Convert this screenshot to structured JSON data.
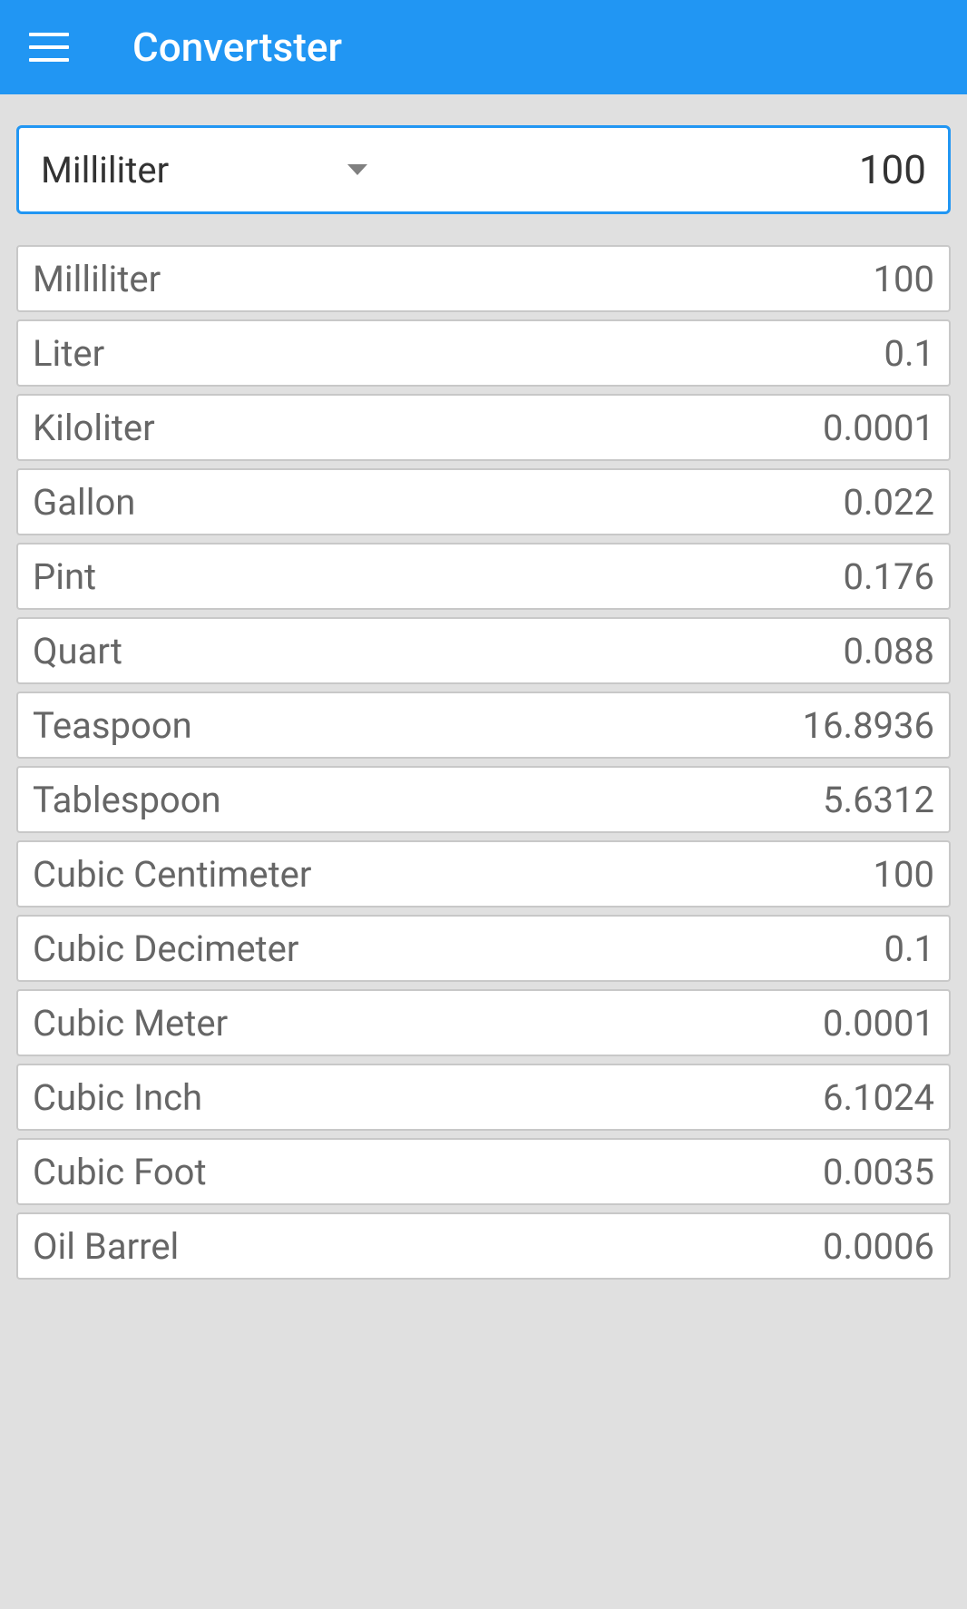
{
  "header": {
    "title": "Convertster"
  },
  "input": {
    "selected_unit": "Milliliter",
    "value": "100"
  },
  "results": [
    {
      "unit": "Milliliter",
      "value": "100"
    },
    {
      "unit": "Liter",
      "value": "0.1"
    },
    {
      "unit": "Kiloliter",
      "value": "0.0001"
    },
    {
      "unit": "Gallon",
      "value": "0.022"
    },
    {
      "unit": "Pint",
      "value": "0.176"
    },
    {
      "unit": "Quart",
      "value": "0.088"
    },
    {
      "unit": "Teaspoon",
      "value": "16.8936"
    },
    {
      "unit": "Tablespoon",
      "value": "5.6312"
    },
    {
      "unit": "Cubic Centimeter",
      "value": "100"
    },
    {
      "unit": "Cubic Decimeter",
      "value": "0.1"
    },
    {
      "unit": "Cubic Meter",
      "value": "0.0001"
    },
    {
      "unit": "Cubic Inch",
      "value": "6.1024"
    },
    {
      "unit": "Cubic Foot",
      "value": "0.0035"
    },
    {
      "unit": "Oil Barrel",
      "value": "0.0006"
    }
  ]
}
